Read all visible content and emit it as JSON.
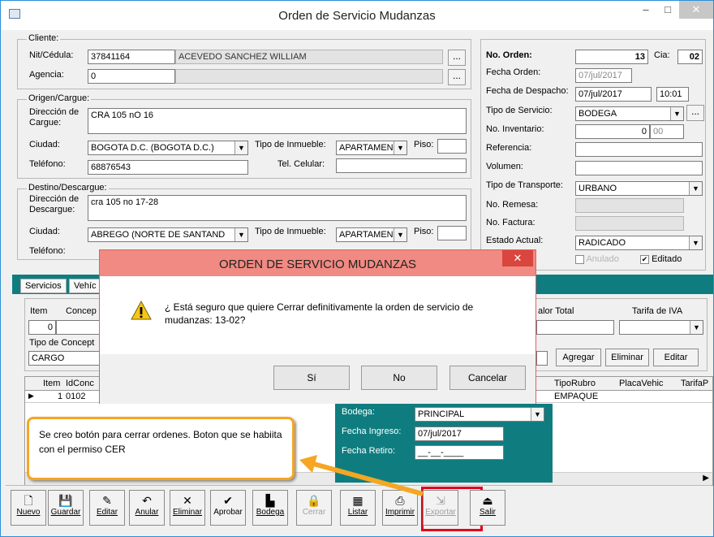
{
  "window": {
    "title": "Orden de Servicio Mudanzas",
    "minimize": "–",
    "maximize": "□",
    "close": "✕"
  },
  "cliente": {
    "group": "Cliente:",
    "nit_label": "Nit/Cédula:",
    "nit": "37841164",
    "nombre": "ACEVEDO SANCHEZ WILLIAM",
    "agencia_label": "Agencia:",
    "agencia": "0",
    "agencia_nombre": "",
    "lookup": "..."
  },
  "origen": {
    "group": "Origen/Cargue:",
    "dir_label": "Dirección de Cargue:",
    "dir": "CRA 105 nO 16",
    "ciudad_label": "Ciudad:",
    "ciudad": "BOGOTA D.C.  (BOGOTA D.C.)",
    "inmueble_label": "Tipo de Inmueble:",
    "inmueble": "APARTAMEN",
    "piso_label": "Piso:",
    "piso": "",
    "tel_label": "Teléfono:",
    "tel": "68876543",
    "cel_label": "Tel. Celular:",
    "cel": ""
  },
  "destino": {
    "group": "Destino/Descargue:",
    "dir_label": "Dirección de Descargue:",
    "dir": "cra 105 no 17-28",
    "ciudad_label": "Ciudad:",
    "ciudad": "ABREGO  (NORTE DE SANTAND",
    "inmueble_label": "Tipo de Inmueble:",
    "inmueble": "APARTAMEN",
    "piso_label": "Piso:",
    "piso": "",
    "tel_label": "Teléfono:"
  },
  "orden": {
    "no_label": "No. Orden:",
    "no": "13",
    "cia_label": "Cia:",
    "cia": "02",
    "fecha_label": "Fecha Orden:",
    "fecha": "07/jul/2017",
    "despacho_label": "Fecha de Despacho:",
    "despacho": "07/jul/2017",
    "hora": "10:01",
    "servicio_label": "Tipo de Servicio:",
    "servicio": "BODEGA",
    "inventario_label": "No. Inventario:",
    "inv_a": "0",
    "inv_b": "00",
    "referencia_label": "Referencia:",
    "volumen_label": "Volumen:",
    "transporte_label": "Tipo de Transporte:",
    "transporte": "URBANO",
    "remesa_label": "No. Remesa:",
    "factura_label": "No. Factura:",
    "estado_label": "Estado Actual:",
    "estado": "RADICADO",
    "anulado": "Anulado",
    "editado": "Editado"
  },
  "tabs": {
    "servicios": "Servicios",
    "vehic": "Vehíc"
  },
  "servicios": {
    "item_label": "Item",
    "concepto_label": "Concep",
    "item": "0",
    "tipo_label": "Tipo de Concept",
    "tipo": "CARGO",
    "valor_label": "alor Total",
    "iva_label": "Tarifa de IVA",
    "agregar": "Agregar",
    "eliminar": "Eliminar",
    "editar": "Editar"
  },
  "grid": {
    "headers": [
      "Item",
      "IdConc",
      "TipoRubro",
      "PlacaVehic",
      "TarifaP"
    ],
    "row": {
      "item": "1",
      "idconc": "0102",
      "tiporubro": "EMPAQUE"
    }
  },
  "bodega": {
    "bodega_label": "Bodega:",
    "bodega": "PRINCIPAL",
    "ingreso_label": "Fecha Ingreso:",
    "ingreso": "07/jul/2017",
    "retiro_label": "Fecha Retiro:",
    "retiro": "__-__-____"
  },
  "dialog": {
    "title": "ORDEN DE SERVICIO MUDANZAS",
    "message": "¿ Está seguro que quiere Cerrar definitivamente la orden de servicio de mudanzas: 13-02?",
    "yes": "Sí",
    "no": "No",
    "cancel": "Cancelar"
  },
  "callout": "Se creo botón para cerrar ordenes. Boton que se habiita con el permiso CER",
  "toolbar": [
    "Nuevo",
    "Guardar",
    "Editar",
    "Anular",
    "Eliminar",
    "Aprobar",
    "Bodega",
    "Cerrar",
    "Listar",
    "Imprimir",
    "Exportar",
    "Salir"
  ],
  "colors": {
    "teal": "#0f7d80",
    "highlight": "#e0001b",
    "callout": "#f5a623"
  }
}
